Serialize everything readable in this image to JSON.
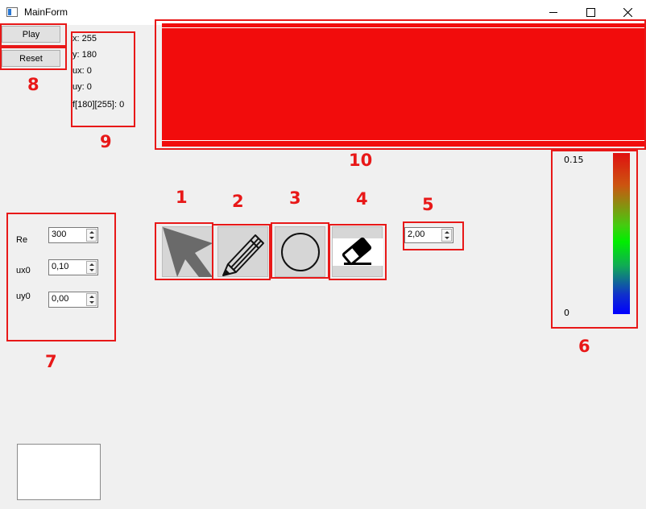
{
  "window": {
    "title": "MainForm",
    "minimize": "–",
    "maximize": "☐",
    "close": "✕"
  },
  "buttons": {
    "play": "Play",
    "reset": "Reset"
  },
  "info": {
    "x": "x: 255",
    "y": "y: 180",
    "ux": "ux: 0",
    "uy": "uy: 0",
    "f": "f[180][255]: 0"
  },
  "params": {
    "re_label": "Re",
    "re_value": "300",
    "ux0_label": "ux0",
    "ux0_value": "0,10",
    "uy0_label": "uy0",
    "uy0_value": "0,00"
  },
  "brush_size": "2,00",
  "colorbar": {
    "max_label": "0.15",
    "min_label": "0"
  },
  "tools": [
    "arrow-icon",
    "pencil-icon",
    "circle-icon",
    "eraser-icon"
  ],
  "annotations": [
    "1",
    "2",
    "3",
    "4",
    "5",
    "6",
    "7",
    "8",
    "9",
    "10"
  ],
  "colors": {
    "annotation_red": "#e81818",
    "canvas_red": "#f20c0c",
    "colorbar_top": "#e01010",
    "colorbar_bottom": "#0000ff"
  }
}
